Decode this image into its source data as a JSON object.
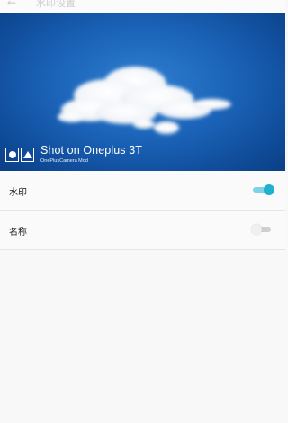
{
  "app_bar": {
    "back_glyph": "←",
    "title": "水印设置"
  },
  "preview": {
    "watermark": {
      "title": "Shot on Oneplus 3T",
      "subtitle": "OnePlusCamera Mod",
      "logo_icon": "circle-triangle-logo",
      "color": "#ffffff"
    },
    "sky_color": "#1b63b8"
  },
  "settings": {
    "items": [
      {
        "label": "水印",
        "toggle_state": "on"
      },
      {
        "label": "名称",
        "toggle_state": "off"
      }
    ]
  },
  "colors": {
    "accent": "#1fb1cd",
    "accent_track": "#7fd3e6",
    "off_track": "#cfcfcf",
    "background": "#f8f8f8"
  }
}
